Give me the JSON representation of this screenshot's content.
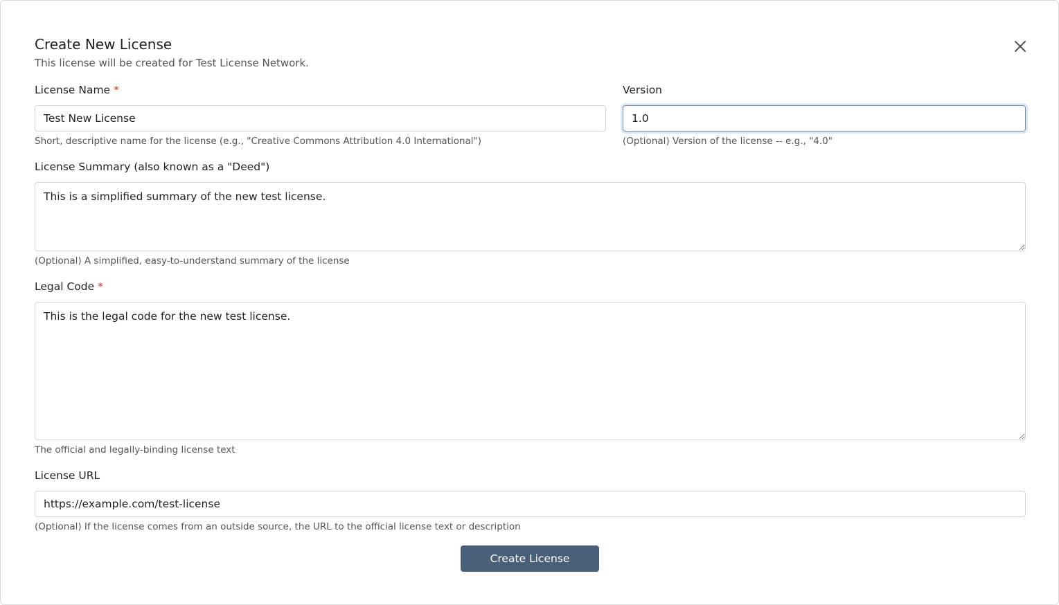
{
  "dialog": {
    "title": "Create New License",
    "subtitle": "This license will be created for Test License Network.",
    "close_icon": "close-icon"
  },
  "form": {
    "name": {
      "label": "License Name",
      "required_mark": "*",
      "value": "Test New License",
      "help": "Short, descriptive name for the license (e.g., \"Creative Commons Attribution 4.0 International\")"
    },
    "version": {
      "label": "Version",
      "value": "1.0",
      "help": "(Optional) Version of the license -- e.g., \"4.0\""
    },
    "summary": {
      "label": "License Summary (also known as a \"Deed\")",
      "value": "This is a simplified summary of the new test license.",
      "help": "(Optional) A simplified, easy-to-understand summary of the license"
    },
    "legal_code": {
      "label": "Legal Code",
      "required_mark": "*",
      "value": "This is the legal code for the new test license.",
      "help": "The official and legally-binding license text"
    },
    "url": {
      "label": "License URL",
      "value": "https://example.com/test-license",
      "help": "(Optional) If the license comes from an outside source, the URL to the official license text or description"
    },
    "submit_label": "Create License"
  },
  "colors": {
    "accent": "#4a5f78",
    "required": "#c0392b",
    "focus_ring": "#dbe8f7"
  }
}
